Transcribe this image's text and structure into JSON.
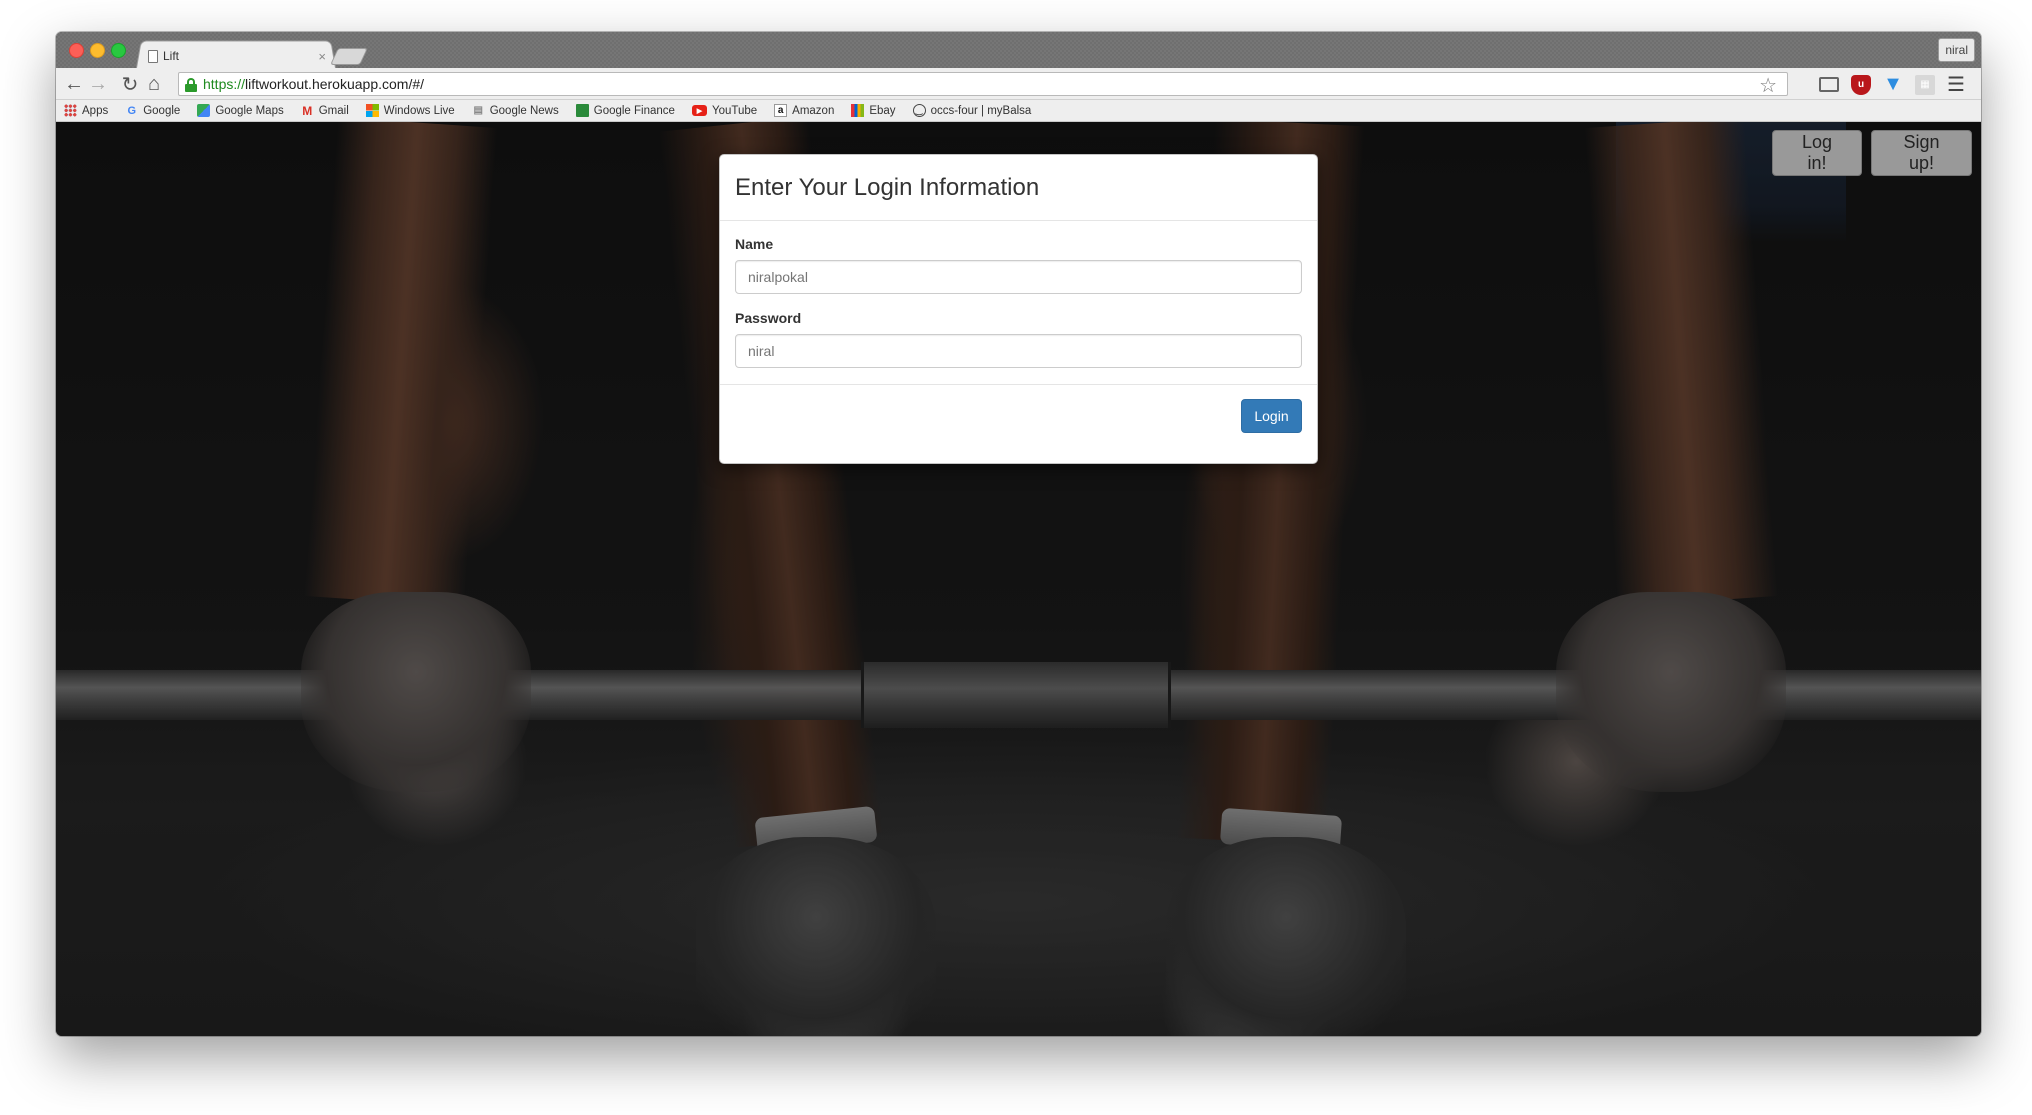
{
  "browser": {
    "tab_title": "Lift",
    "tab_close": "×",
    "profile_name": "niral",
    "url_scheme": "https://",
    "url_rest": "liftworkout.herokuapp.com/#/",
    "bookmarks": [
      {
        "label": "Apps",
        "icon": "apps-grid-icon"
      },
      {
        "label": "Google",
        "icon": "google-icon"
      },
      {
        "label": "Google Maps",
        "icon": "maps-icon"
      },
      {
        "label": "Gmail",
        "icon": "gmail-icon"
      },
      {
        "label": "Windows Live",
        "icon": "windows-icon"
      },
      {
        "label": "Google News",
        "icon": "news-icon"
      },
      {
        "label": "Google Finance",
        "icon": "finance-icon"
      },
      {
        "label": "YouTube",
        "icon": "youtube-icon"
      },
      {
        "label": "Amazon",
        "icon": "amazon-icon"
      },
      {
        "label": "Ebay",
        "icon": "ebay-icon"
      },
      {
        "label": "occs-four | myBalsa",
        "icon": "smiley-icon"
      }
    ]
  },
  "header": {
    "login_label": "Log in!",
    "signup_label": "Sign up!"
  },
  "modal": {
    "title": "Enter Your Login Information",
    "name_label": "Name",
    "name_placeholder": "niralpokal",
    "password_label": "Password",
    "password_placeholder": "niral",
    "submit_label": "Login"
  },
  "colors": {
    "primary": "#337ab7",
    "secondary_button": "#999999",
    "url_secure": "#1e8a1e"
  }
}
